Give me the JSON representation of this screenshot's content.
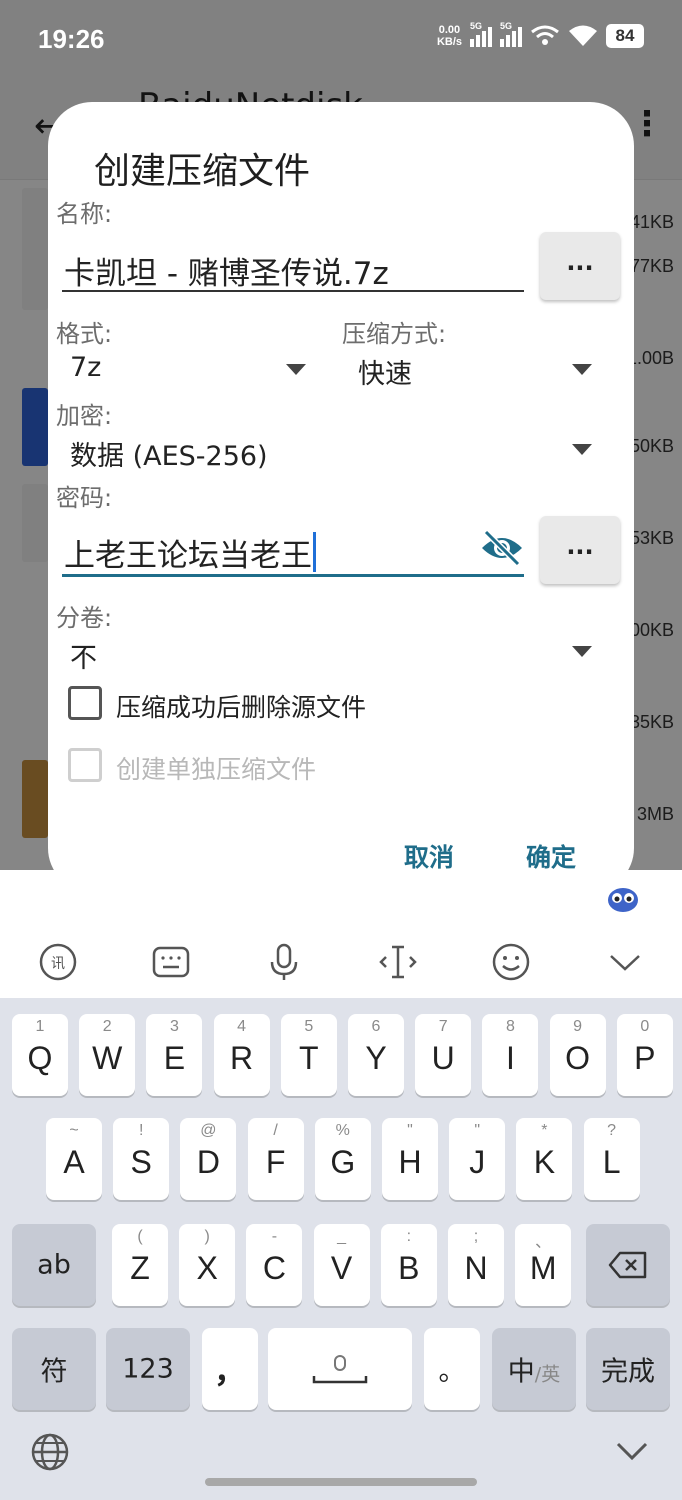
{
  "status_bar": {
    "time": "19:26",
    "net_speed_value": "0.00",
    "net_speed_unit": "KB/s",
    "signal_1_label": "5G",
    "signal_2_label": "5G",
    "battery": "84"
  },
  "app": {
    "title": "BaiduNetdisk",
    "file_sizes": [
      "41KB",
      "77KB",
      "1.00B",
      "50KB",
      "53KB",
      "00KB",
      "35KB",
      "3MB"
    ]
  },
  "dialog": {
    "title": "创建压缩文件",
    "name_label": "名称:",
    "name_value": "卡凯坦 - 赌博圣传说.7z",
    "more_label": "...",
    "format_label": "格式:",
    "format_value": "7z",
    "method_label": "压缩方式:",
    "method_value": "快速",
    "encryption_label": "加密:",
    "encryption_value": "数据 (AES-256)",
    "password_label": "密码:",
    "password_value": "上老王论坛当老王",
    "split_label": "分卷:",
    "split_value": "不",
    "delete_source_label": "压缩成功后删除源文件",
    "delete_source_checked": false,
    "separate_archive_label": "创建单独压缩文件",
    "separate_archive_checked": false,
    "cancel_label": "取消",
    "ok_label": "确定",
    "accent_color": "#1f6d8a"
  },
  "keyboard": {
    "row1": [
      {
        "hint": "1",
        "key": "Q"
      },
      {
        "hint": "2",
        "key": "W"
      },
      {
        "hint": "3",
        "key": "E"
      },
      {
        "hint": "4",
        "key": "R"
      },
      {
        "hint": "5",
        "key": "T"
      },
      {
        "hint": "6",
        "key": "Y"
      },
      {
        "hint": "7",
        "key": "U"
      },
      {
        "hint": "8",
        "key": "I"
      },
      {
        "hint": "9",
        "key": "O"
      },
      {
        "hint": "0",
        "key": "P"
      }
    ],
    "row2": [
      {
        "hint": "~",
        "key": "A"
      },
      {
        "hint": "!",
        "key": "S"
      },
      {
        "hint": "@",
        "key": "D"
      },
      {
        "hint": "/",
        "key": "F"
      },
      {
        "hint": "%",
        "key": "G"
      },
      {
        "hint": "\"",
        "key": "H"
      },
      {
        "hint": "\"",
        "key": "J"
      },
      {
        "hint": "*",
        "key": "K"
      },
      {
        "hint": "?",
        "key": "L"
      }
    ],
    "row3": [
      {
        "hint": "(",
        "key": "Z"
      },
      {
        "hint": ")",
        "key": "X"
      },
      {
        "hint": "-",
        "key": "C"
      },
      {
        "hint": "_",
        "key": "V"
      },
      {
        "hint": ":",
        "key": "B"
      },
      {
        "hint": ";",
        "key": "N"
      },
      {
        "hint": "、",
        "key": "M"
      }
    ],
    "ab_label": "ab",
    "symbol_label": "符",
    "num_label": "123",
    "comma_label": "，",
    "period_label": "。",
    "lang_main": "中",
    "lang_alt": "/英",
    "done_label": "完成"
  }
}
